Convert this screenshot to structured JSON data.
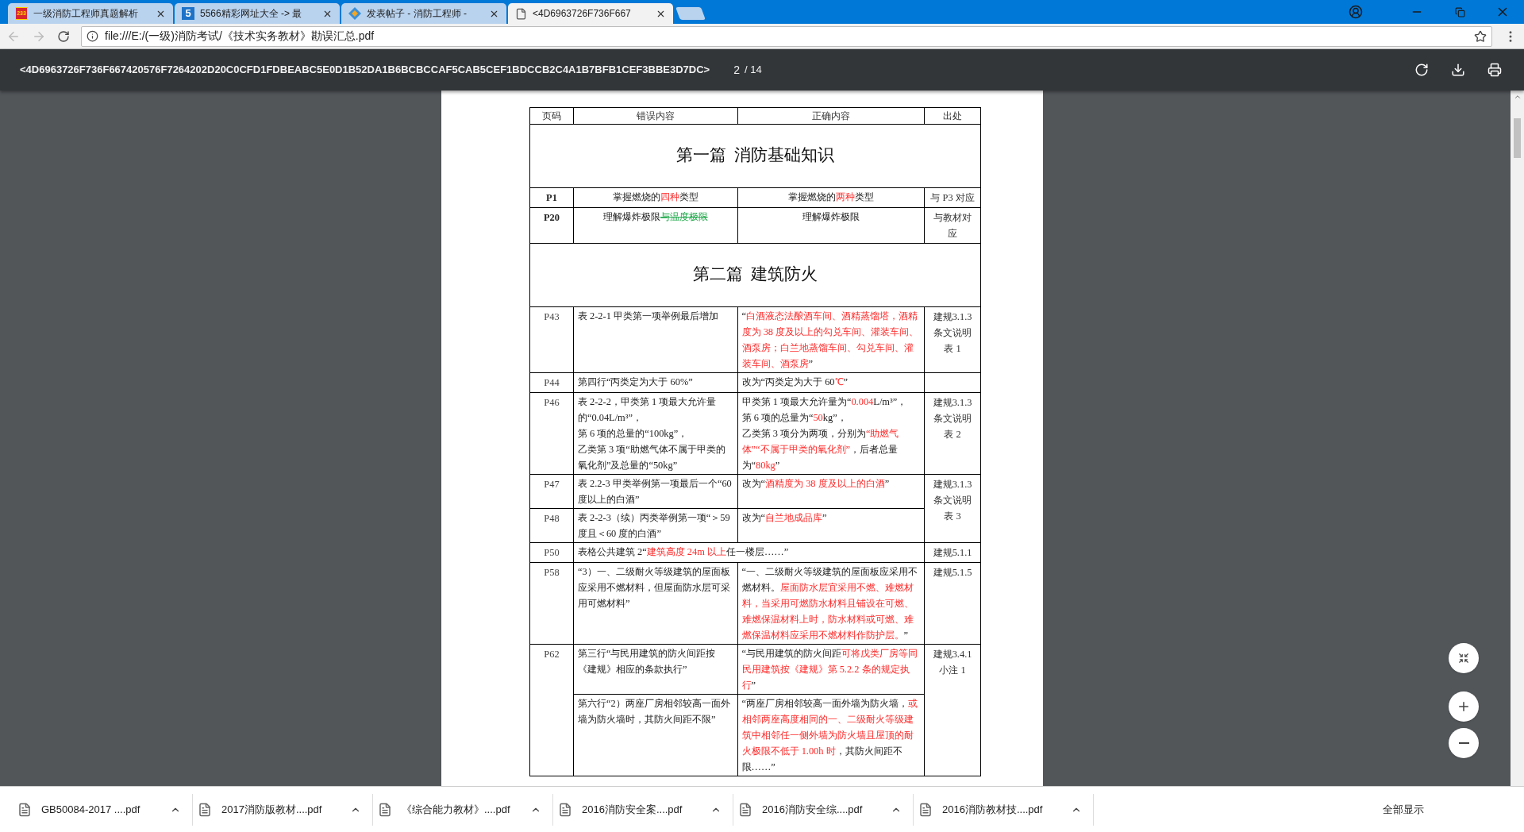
{
  "tabs": [
    {
      "title": "一级消防工程师真题解析",
      "kind": "badge",
      "icon_text": "233",
      "selected": false
    },
    {
      "title": "5566精彩网址大全 -> 最",
      "kind": "square",
      "icon_text": "5",
      "selected": false
    },
    {
      "title": "发表帖子 - 消防工程师 -",
      "kind": "diamond",
      "selected": false
    },
    {
      "title": "<4D6963726F736F667",
      "kind": "page",
      "selected": true
    }
  ],
  "address": {
    "url": "file:///E:/(一级)消防考试/《技术实务教材》勘误汇总.pdf"
  },
  "pdf_toolbar": {
    "title": "<4D6963726F736F667420576F7264202D20C0CFD1FDBEABC5E0D1B52DA1B6BCBCCAF5CAB5CEF1BDCCB2C4A1B7BFB1CEF3BBE3D7DC>",
    "current_page": "2",
    "page_total": "/ 14"
  },
  "table": {
    "columns": [
      "页码",
      "错误内容",
      "正确内容",
      "出处"
    ],
    "rows": [
      {
        "kind": "section",
        "title": "第一篇  消防基础知识"
      },
      {
        "kind": "brief",
        "source": [
          "与 P3 对应"
        ],
        "pages": [
          {
            "page": "P1",
            "parts": [
              {
                "kind": "split",
                "wrong": [
                  [
                    {
                      "text": "掌握燃烧的",
                      "kind": "plain"
                    },
                    {
                      "text": "四种",
                      "kind": "highlight"
                    },
                    {
                      "text": "类型",
                      "kind": "plain"
                    }
                  ]
                ],
                "correct": [
                  [
                    {
                      "text": "掌握燃烧的",
                      "kind": "plain"
                    },
                    {
                      "text": "两种",
                      "kind": "highlight"
                    },
                    {
                      "text": "类型",
                      "kind": "plain"
                    }
                  ]
                ]
              }
            ]
          }
        ]
      },
      {
        "kind": "brief",
        "source": [
          "与教材对",
          "应"
        ],
        "pages": [
          {
            "page": "P20",
            "parts": [
              {
                "kind": "split",
                "wrong": [
                  [
                    {
                      "text": "理解爆炸极限",
                      "kind": "plain"
                    },
                    {
                      "text": "与温度极限",
                      "kind": "deleted"
                    }
                  ]
                ],
                "correct": [
                  [
                    {
                      "text": "理解爆炸极限",
                      "kind": "plain"
                    }
                  ]
                ]
              }
            ]
          }
        ]
      },
      {
        "kind": "section",
        "title": "第二篇  建筑防火"
      },
      {
        "kind": "entry",
        "source": [
          "建规3.1.3",
          "条文说明",
          "表 1"
        ],
        "pages": [
          {
            "page": "P43",
            "parts": [
              {
                "kind": "split",
                "wrong": [
                  [
                    {
                      "text": "表 2-2-1 甲类第一项举例最后增加",
                      "kind": "plain"
                    }
                  ]
                ],
                "correct": [
                  [
                    {
                      "text": "“",
                      "kind": "plain"
                    },
                    {
                      "text": "白酒液态法酿酒车间、酒精蒸馏塔，酒精度为 38 度及以上的勾兑车间、灌装车间、酒泵房；白兰地蒸馏车间、勾兑车间、灌装车间、酒泵房",
                      "kind": "highlight"
                    },
                    {
                      "text": "”",
                      "kind": "plain"
                    }
                  ]
                ]
              }
            ]
          }
        ]
      },
      {
        "kind": "entry",
        "pages": [
          {
            "page": "P44",
            "parts": [
              {
                "kind": "split",
                "wrong": [
                  [
                    {
                      "text": "第四行“丙类定为大于 60%”",
                      "kind": "plain"
                    }
                  ]
                ],
                "correct": [
                  [
                    {
                      "text": "改为“丙类定为大于 60",
                      "kind": "plain"
                    },
                    {
                      "text": "℃",
                      "kind": "highlight"
                    },
                    {
                      "text": "”",
                      "kind": "plain"
                    }
                  ]
                ]
              }
            ]
          }
        ]
      },
      {
        "kind": "entry",
        "source": [
          "建规3.1.3",
          "条文说明",
          "表 2"
        ],
        "pages": [
          {
            "page": "P46",
            "parts": [
              {
                "kind": "split",
                "wrong": [
                  [
                    {
                      "text": "表 2-2-2，甲类第 1 项最大允许量的“0.04L/m³”，",
                      "kind": "plain"
                    }
                  ],
                  [
                    {
                      "text": "第 6 项的总量的“100kg”，",
                      "kind": "plain"
                    }
                  ],
                  [
                    {
                      "text": "乙类第 3 项“助燃气体不属于甲类的氧化剂”及总量的“50kg”",
                      "kind": "plain"
                    }
                  ]
                ],
                "correct": [
                  [
                    {
                      "text": "甲类第 1 项最大允许量为“",
                      "kind": "plain"
                    },
                    {
                      "text": "0.004",
                      "kind": "highlight"
                    },
                    {
                      "text": "L/m³”，",
                      "kind": "plain"
                    }
                  ],
                  [
                    {
                      "text": "第 6 项的总量为“",
                      "kind": "plain"
                    },
                    {
                      "text": "50",
                      "kind": "highlight"
                    },
                    {
                      "text": "kg”，",
                      "kind": "plain"
                    }
                  ],
                  [
                    {
                      "text": "乙类第 3 项分为两项，分别为",
                      "kind": "plain"
                    },
                    {
                      "text": "“助燃气体”“不属于甲类的氧化剂”",
                      "kind": "highlight"
                    },
                    {
                      "text": "，后者总量为“",
                      "kind": "plain"
                    },
                    {
                      "text": "80kg",
                      "kind": "highlight"
                    },
                    {
                      "text": "”",
                      "kind": "plain"
                    }
                  ]
                ]
              }
            ]
          }
        ]
      },
      {
        "kind": "entry",
        "source": [
          "建规3.1.3",
          "条文说明",
          "表 3"
        ],
        "pages": [
          {
            "page": "P47",
            "parts": [
              {
                "kind": "split",
                "wrong": [
                  [
                    {
                      "text": "表 2.2-3 甲类举例第一项最后一个“60 度以上的白酒”",
                      "kind": "plain"
                    }
                  ]
                ],
                "correct": [
                  [
                    {
                      "text": "改为“",
                      "kind": "plain"
                    },
                    {
                      "text": "酒精度为 38 度及以上的白酒",
                      "kind": "highlight"
                    },
                    {
                      "text": "”",
                      "kind": "plain"
                    }
                  ]
                ]
              }
            ]
          },
          {
            "page": "P48",
            "parts": [
              {
                "kind": "split",
                "wrong": [
                  [
                    {
                      "text": "表 2-2-3（续）丙类举例第一项“＞59 度且＜60 度的白酒”",
                      "kind": "plain"
                    }
                  ]
                ],
                "correct": [
                  [
                    {
                      "text": "改为“",
                      "kind": "plain"
                    },
                    {
                      "text": "自兰地成品库",
                      "kind": "highlight"
                    },
                    {
                      "text": "”",
                      "kind": "plain"
                    }
                  ]
                ]
              }
            ]
          }
        ]
      },
      {
        "kind": "entry",
        "source": [
          "建规5.1.1"
        ],
        "pages": [
          {
            "page": "P50",
            "parts": [
              {
                "kind": "wide",
                "wrong": [
                  [
                    {
                      "text": "表格公共建筑 2“",
                      "kind": "plain"
                    },
                    {
                      "text": "建筑高度 24m 以上",
                      "kind": "highlight"
                    },
                    {
                      "text": "任一楼层……”",
                      "kind": "plain"
                    }
                  ]
                ]
              }
            ]
          }
        ]
      },
      {
        "kind": "entry",
        "source": [
          "建规5.1.5"
        ],
        "pages": [
          {
            "page": "P58",
            "parts": [
              {
                "kind": "split",
                "wrong": [
                  [
                    {
                      "text": "“3）一、二级耐火等级建筑的屋面板应采用不燃材料，但屋面防水层可采用可燃材料”",
                      "kind": "plain"
                    }
                  ]
                ],
                "correct": [
                  [
                    {
                      "text": "“一、二级耐火等级建筑的屋面板应采用不燃材料。",
                      "kind": "plain"
                    },
                    {
                      "text": "屋面防水层宜采用不燃、难燃材料，当采用可燃防水材料且铺设在可燃、难燃保温材料上时，防水材料或可燃、难燃保温材料应采用不燃材料作防护层。",
                      "kind": "highlight"
                    },
                    {
                      "text": "”",
                      "kind": "plain"
                    }
                  ]
                ]
              }
            ]
          }
        ]
      },
      {
        "kind": "entry",
        "source": [
          "建规3.4.1",
          "小注 1"
        ],
        "pages": [
          {
            "page": "P62",
            "parts": [
              {
                "kind": "split",
                "wrong": [
                  [
                    {
                      "text": "第三行“与民用建筑的防火间距按《建规》相应的条款执行”",
                      "kind": "plain"
                    }
                  ]
                ],
                "correct": [
                  [
                    {
                      "text": "“与民用建筑的防火间距",
                      "kind": "plain"
                    },
                    {
                      "text": "可将戊类厂房等同民用建筑按《建规》第 5.2.2 条的规定执行",
                      "kind": "highlight"
                    },
                    {
                      "text": "”",
                      "kind": "plain"
                    }
                  ]
                ]
              },
              {
                "kind": "split",
                "wrong": [
                  [
                    {
                      "text": "第六行“2）两座厂房相邻较高一面外墙为防火墙时，其防火间距不限”",
                      "kind": "plain"
                    }
                  ]
                ],
                "correct": [
                  [
                    {
                      "text": "“两座厂房相邻较高一面外墙为防火墙，",
                      "kind": "plain"
                    },
                    {
                      "text": "或相邻两座高度相同的一、二级耐火等级建筑中相邻任一侧外墙为防火墙且屋顶的耐火极限不低于 1.00h 时",
                      "kind": "highlight"
                    },
                    {
                      "text": "，其防火间距不限……”",
                      "kind": "plain"
                    }
                  ]
                ]
              }
            ]
          }
        ]
      }
    ]
  },
  "downloads": [
    {
      "name": "GB50084-2017 ....pdf"
    },
    {
      "name": "2017消防版教材....pdf"
    },
    {
      "name": "《综合能力教材》....pdf"
    },
    {
      "name": "2016消防安全案....pdf"
    },
    {
      "name": "2016消防安全综....pdf"
    },
    {
      "name": "2016消防教材技....pdf"
    }
  ],
  "show_all_button": "全部显示"
}
